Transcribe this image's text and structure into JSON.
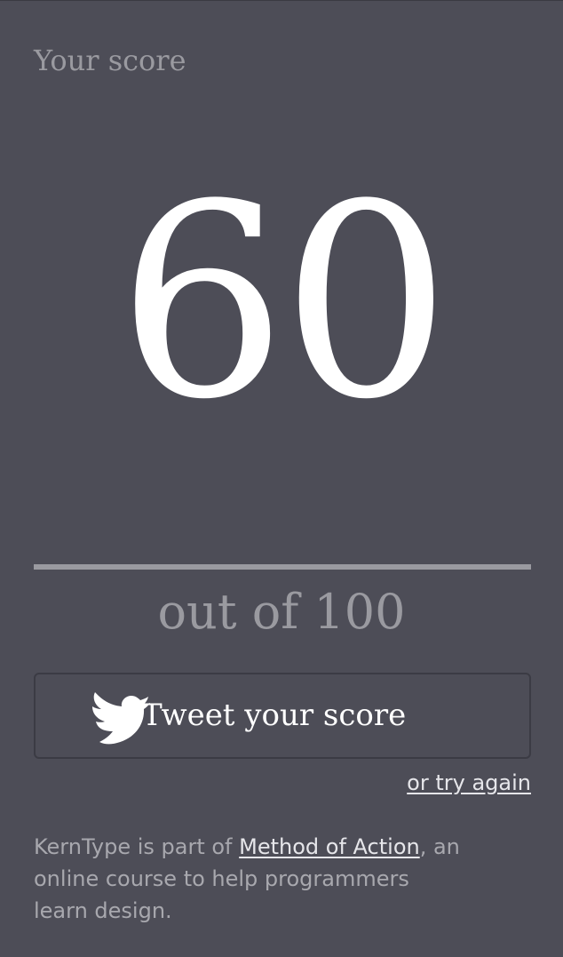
{
  "score": {
    "label": "Your score",
    "value": "60",
    "out_of": "out of 100"
  },
  "tweet_button": {
    "label": "Tweet your score",
    "icon": "twitter-bird-icon"
  },
  "retry": {
    "label": "or try again"
  },
  "footer": {
    "text_before": "KernType is part of ",
    "link_label": "Method of Action",
    "text_after_line1": ", an",
    "text_line2": "online course to help programmers",
    "text_line3": "learn design."
  },
  "colors": {
    "background": "#4d4d57",
    "muted": "#9a9aa0",
    "text": "#ffffff",
    "link": "#e6e6ea"
  }
}
